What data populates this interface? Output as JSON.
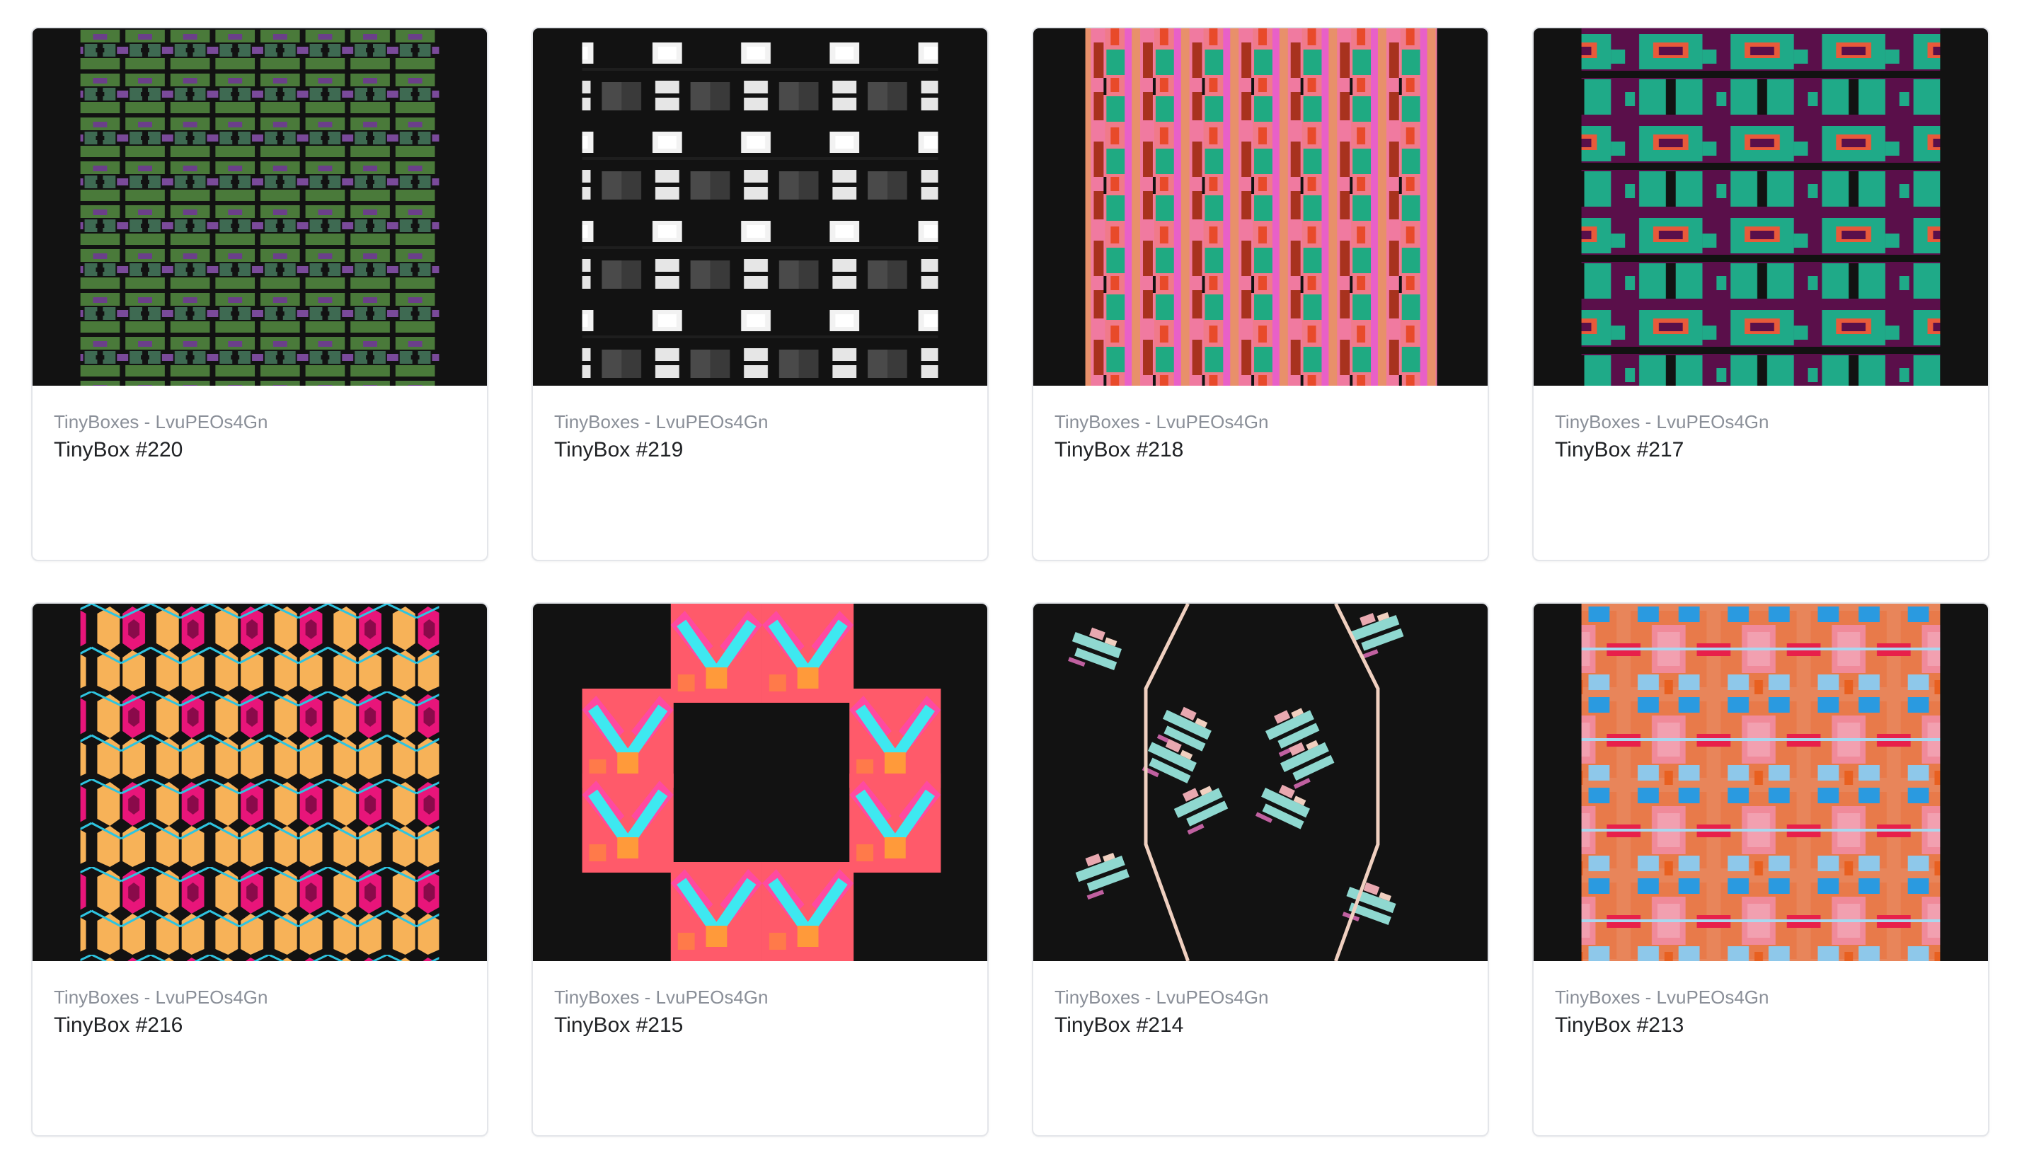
{
  "cards": [
    {
      "collection": "TinyBoxes - LvuPEOs4Gn",
      "title": "TinyBox #220"
    },
    {
      "collection": "TinyBoxes - LvuPEOs4Gn",
      "title": "TinyBox #219"
    },
    {
      "collection": "TinyBoxes - LvuPEOs4Gn",
      "title": "TinyBox #218"
    },
    {
      "collection": "TinyBoxes - LvuPEOs4Gn",
      "title": "TinyBox #217"
    },
    {
      "collection": "TinyBoxes - LvuPEOs4Gn",
      "title": "TinyBox #216"
    },
    {
      "collection": "TinyBoxes - LvuPEOs4Gn",
      "title": "TinyBox #215"
    },
    {
      "collection": "TinyBoxes - LvuPEOs4Gn",
      "title": "TinyBox #214"
    },
    {
      "collection": "TinyBoxes - LvuPEOs4Gn",
      "title": "TinyBox #213"
    }
  ],
  "colors": {
    "thumb_background": "#121212",
    "card_border": "#e4e6ea",
    "collection_text": "#8a8f98",
    "title_text": "#202225"
  }
}
